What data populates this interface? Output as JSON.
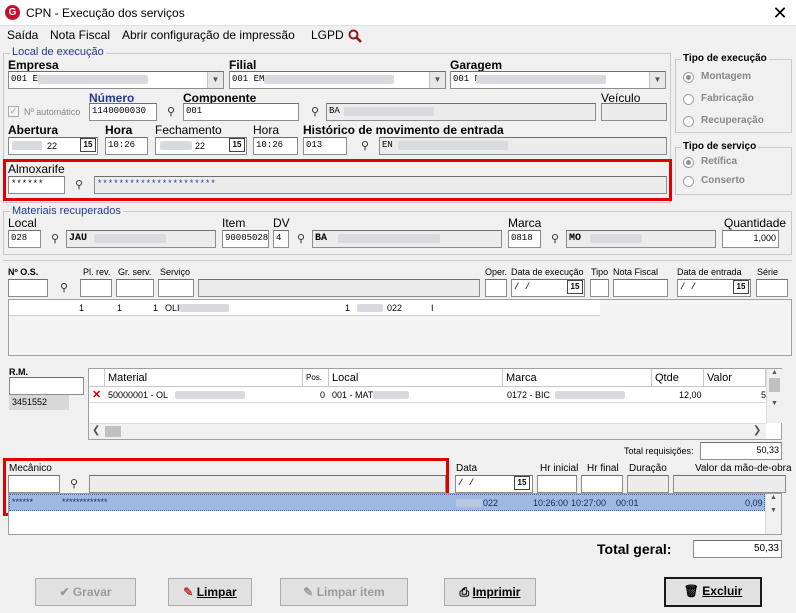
{
  "window": {
    "title": "CPN - Execução dos serviços",
    "close": "✕"
  },
  "menu": {
    "items": [
      "Saída",
      "Nota Fiscal",
      "Abrir configuração de impressão",
      "LGPD"
    ]
  },
  "local_execucao": {
    "legend": "Local de execução",
    "empresa_label": "Empresa",
    "empresa_value": "001 EM",
    "filial_label": "Filial",
    "filial_value": "001 EM",
    "garagem_label": "Garagem",
    "garagem_value": "001 D",
    "auto_label": "Nº automático",
    "numero_label": "Número",
    "numero_value": "1140000030",
    "componente_label": "Componente",
    "componente_value": "001",
    "componente_desc": "BA",
    "veiculo_label": "Veículo",
    "abertura_label": "Abertura",
    "abertura_value": "22",
    "hora_label": "Hora",
    "hora_value": "10:26",
    "fechamento_label": "Fechamento",
    "fechamento_value": "22",
    "hora2_label": "Hora",
    "hora2_value": "10:26",
    "historico_label": "Histórico de movimento de entrada",
    "historico_value": "013",
    "historico_desc": "EN",
    "almox_label": "Almoxarife",
    "almox_code": "******",
    "almox_name": "**********************",
    "cal_icon": "15"
  },
  "tipo_execucao": {
    "legend": "Tipo de execução",
    "options": [
      "Montagem",
      "Fabricação",
      "Recuperação"
    ]
  },
  "tipo_servico": {
    "legend": "Tipo de serviço",
    "options": [
      "Retífica",
      "Conserto"
    ]
  },
  "materiais": {
    "legend": "Materiais recuperados",
    "local_label": "Local",
    "local_value": "028",
    "local_desc": "JAU",
    "item_label": "Item",
    "item_value": "90005028",
    "dv_label": "DV",
    "dv_value": "4",
    "item_desc": "BA",
    "marca_label": "Marca",
    "marca_value": "0818",
    "marca_desc": "MO",
    "qtd_label": "Quantidade",
    "qtd_value": "1,000"
  },
  "os": {
    "headers": [
      "Nº O.S.",
      "Pl. rev.",
      "Gr. serv.",
      "Serviço",
      "Oper.",
      "Data de execução",
      "Tipo",
      "Nota Fiscal",
      "Data de entrada",
      "Série"
    ],
    "date_placeholder": "/ /",
    "row": [
      "1",
      "1",
      "1",
      "OLI",
      "1",
      "022",
      "I"
    ]
  },
  "rm": {
    "label": "R.M.",
    "value": "3451552"
  },
  "materials_grid": {
    "headers": [
      "Material",
      "Pos.",
      "Local",
      "Marca",
      "Qtde",
      "Valor"
    ],
    "row": {
      "material": "50000001 - OL",
      "pos": "0",
      "local": "001 - MAT",
      "marca": "0172 - BIC",
      "qtde": "12,00",
      "valor": "5"
    },
    "total_label": "Total requisições:",
    "total_value": "50,33"
  },
  "mecanico": {
    "label": "Mecânico",
    "headers": [
      "Data",
      "Hr inicial",
      "Hr final",
      "Duração",
      "Valor da mão-de-obra"
    ],
    "date_placeholder": "/ /",
    "row": {
      "code": "******",
      "name": "*************",
      "data": "022",
      "hr_ini": "10:26:00",
      "hr_fim": "10:27:00",
      "duracao": "00:01",
      "valor": "0,09"
    }
  },
  "total_geral": {
    "label": "Total geral:",
    "value": "50,33"
  },
  "buttons": {
    "gravar": "Gravar",
    "limpar": "Limpar",
    "limpar_item": "Limpar item",
    "imprimir": "Imprimir",
    "excluir": "Excluir"
  }
}
